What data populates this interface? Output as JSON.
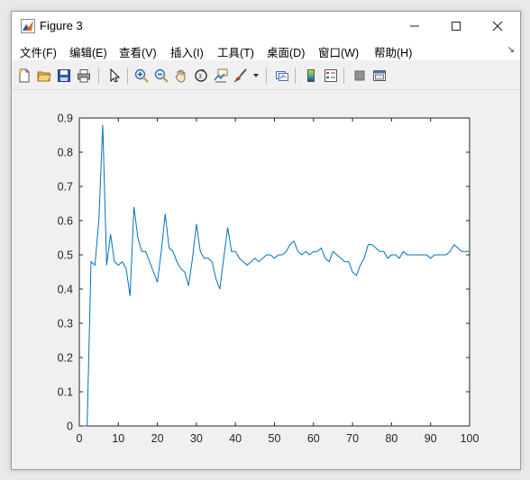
{
  "window": {
    "title": "Figure 3"
  },
  "controls": {
    "minimize": "—",
    "maximize": "☐",
    "close": "✕"
  },
  "menu": {
    "items": [
      {
        "label": "文件(F)"
      },
      {
        "label": "编辑(E)"
      },
      {
        "label": "查看(V)"
      },
      {
        "label": "插入(I)"
      },
      {
        "label": "工具(T)"
      },
      {
        "label": "桌面(D)"
      },
      {
        "label": "窗口(W)"
      },
      {
        "label": "帮助(H)"
      }
    ],
    "overflow_icon": "chevron-double-icon"
  },
  "toolbar": {
    "icons": [
      "new-figure-icon",
      "open-file-icon",
      "save-icon",
      "print-icon",
      "pointer-icon",
      "zoom-in-icon",
      "zoom-out-icon",
      "pan-icon",
      "rotate-3d-icon",
      "data-cursor-icon",
      "brush-icon",
      "dropdown-arrow-icon",
      "link-plot-icon",
      "colorbar-icon",
      "legend-icon",
      "hide-plot-tools-icon",
      "show-plot-tools-icon"
    ]
  },
  "colors": {
    "line": "#0072bd",
    "axes_bg": "#ffffff",
    "figure_bg": "#f0f0f0"
  },
  "chart_data": {
    "type": "line",
    "title": "",
    "xlabel": "",
    "ylabel": "",
    "xlim": [
      0,
      100
    ],
    "ylim": [
      0,
      0.9
    ],
    "xticks": [
      0,
      10,
      20,
      30,
      40,
      50,
      60,
      70,
      80,
      90,
      100
    ],
    "yticks": [
      0,
      0.1,
      0.2,
      0.3,
      0.4,
      0.5,
      0.6,
      0.7,
      0.8,
      0.9
    ],
    "grid": false,
    "series": [
      {
        "x": [
          1,
          2,
          3,
          4,
          5,
          6,
          7,
          8,
          9,
          10,
          11,
          12,
          13,
          14,
          15,
          16,
          17,
          18,
          19,
          20,
          21,
          22,
          23,
          24,
          25,
          26,
          27,
          28,
          29,
          30,
          31,
          32,
          33,
          34,
          35,
          36,
          37,
          38,
          39,
          40,
          41,
          42,
          43,
          44,
          45,
          46,
          47,
          48,
          49,
          50,
          51,
          52,
          53,
          54,
          55,
          56,
          57,
          58,
          59,
          60,
          61,
          62,
          63,
          64,
          65,
          66,
          67,
          68,
          69,
          70,
          71,
          72,
          73,
          74,
          75,
          76,
          77,
          78,
          79,
          80,
          81,
          82,
          83,
          84,
          85,
          86,
          87,
          88,
          89,
          90,
          91,
          92,
          93,
          94,
          95,
          96,
          97,
          98,
          99,
          100
        ],
        "y": [
          0,
          0,
          0.48,
          0.47,
          0.6,
          0.88,
          0.47,
          0.56,
          0.48,
          0.47,
          0.48,
          0.46,
          0.38,
          0.64,
          0.55,
          0.51,
          0.51,
          0.48,
          0.45,
          0.42,
          0.51,
          0.62,
          0.52,
          0.51,
          0.48,
          0.46,
          0.45,
          0.41,
          0.49,
          0.59,
          0.51,
          0.49,
          0.49,
          0.48,
          0.43,
          0.4,
          0.49,
          0.58,
          0.51,
          0.51,
          0.49,
          0.48,
          0.47,
          0.48,
          0.49,
          0.48,
          0.49,
          0.5,
          0.5,
          0.49,
          0.5,
          0.5,
          0.51,
          0.53,
          0.54,
          0.51,
          0.5,
          0.51,
          0.5,
          0.51,
          0.51,
          0.52,
          0.49,
          0.48,
          0.51,
          0.5,
          0.49,
          0.48,
          0.48,
          0.45,
          0.44,
          0.47,
          0.49,
          0.53,
          0.53,
          0.52,
          0.51,
          0.51,
          0.49,
          0.5,
          0.5,
          0.49,
          0.51,
          0.5,
          0.5,
          0.5,
          0.5,
          0.5,
          0.5,
          0.49,
          0.5,
          0.5,
          0.5,
          0.5,
          0.51,
          0.53,
          0.52,
          0.51,
          0.51,
          0.51
        ]
      }
    ]
  }
}
